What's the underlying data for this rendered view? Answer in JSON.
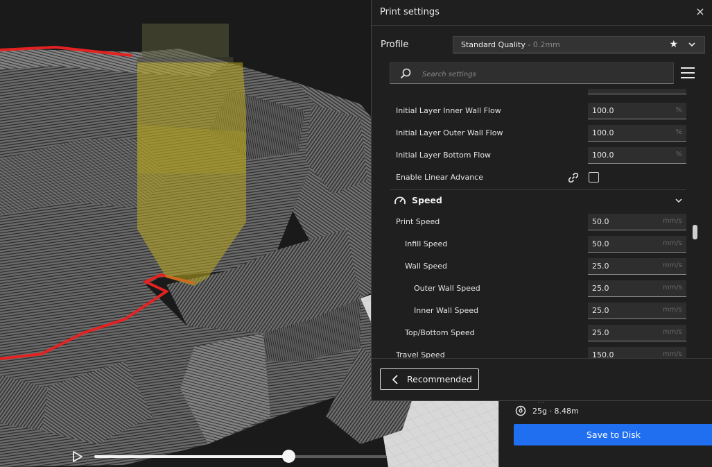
{
  "panel": {
    "title": "Print settings",
    "close": "×",
    "profile_label": "Profile",
    "profile_value": "Standard Quality",
    "profile_sub": " - 0.2mm",
    "search_placeholder": "Search settings"
  },
  "settings": [
    {
      "label": "Initial Layer Inner Wall Flow",
      "value": "100.0",
      "unit": "%"
    },
    {
      "label": "Initial Layer Outer Wall Flow",
      "value": "100.0",
      "unit": "%"
    },
    {
      "label": "Initial Layer Bottom Flow",
      "value": "100.0",
      "unit": "%"
    },
    {
      "label": "Enable Linear Advance",
      "checked": false
    }
  ],
  "speed_section": {
    "title": "Speed",
    "items": [
      {
        "label": "Print Speed",
        "value": "50.0",
        "unit": "mm/s"
      },
      {
        "label": "Infill Speed",
        "value": "50.0",
        "unit": "mm/s"
      },
      {
        "label": "Wall Speed",
        "value": "25.0",
        "unit": "mm/s"
      },
      {
        "label": "Outer Wall Speed",
        "value": "25.0",
        "unit": "mm/s"
      },
      {
        "label": "Inner Wall Speed",
        "value": "25.0",
        "unit": "mm/s"
      },
      {
        "label": "Top/Bottom Speed",
        "value": "25.0",
        "unit": "mm/s"
      },
      {
        "label": "Travel Speed",
        "value": "150.0",
        "unit": "mm/s"
      }
    ]
  },
  "footer": {
    "recommended_label": "Recommended"
  },
  "action": {
    "estimate": "25g · 8.48m",
    "save_label": "Save to Disk"
  },
  "playback": {
    "progress": 0.665
  },
  "colors": {
    "accent": "#1f6ff0",
    "outline_red": "#e32222",
    "nozzle": "#b9a81f"
  }
}
